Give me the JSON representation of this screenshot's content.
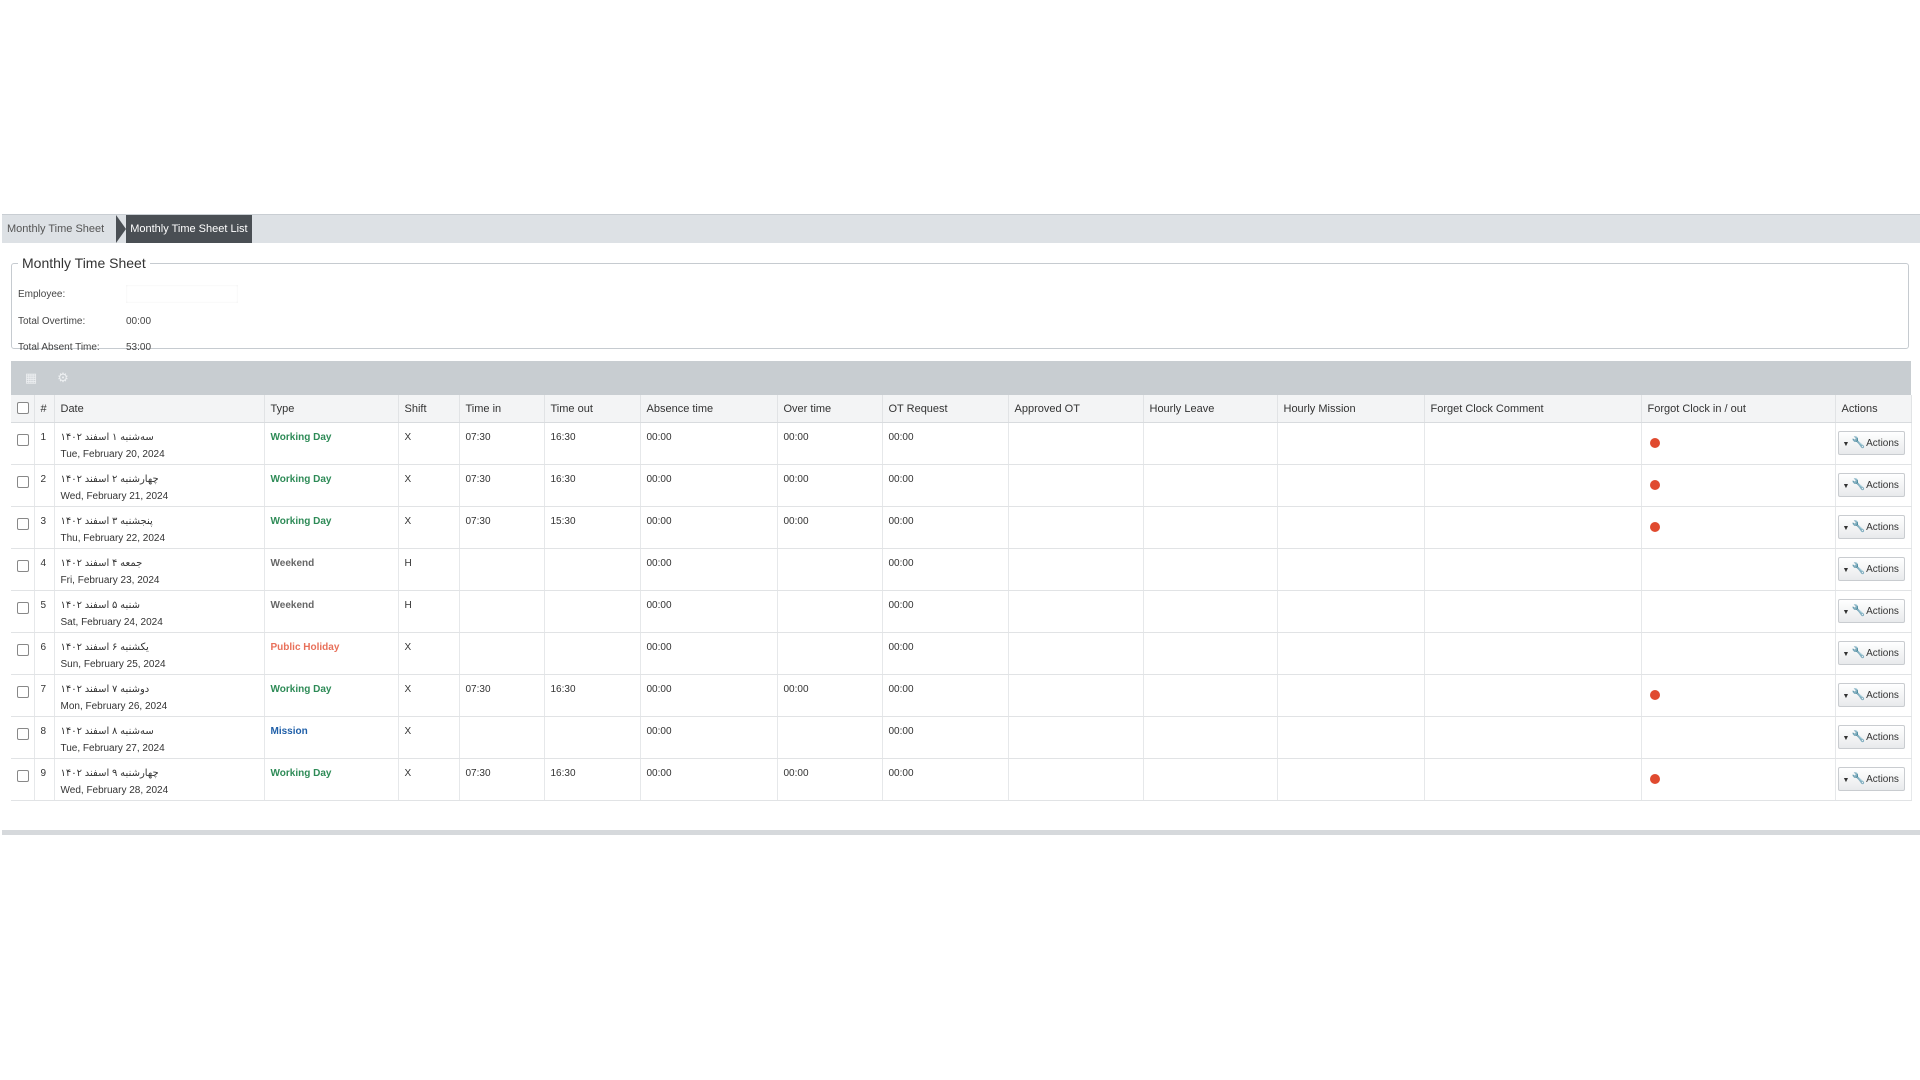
{
  "breadcrumb": {
    "parent": "Monthly Time Sheet",
    "current": "Monthly Time Sheet List"
  },
  "summary": {
    "legend": "Monthly Time Sheet",
    "employee_label": "Employee:",
    "employee_value": "",
    "overtime_label": "Total Overtime:",
    "overtime_value": "00:00",
    "absent_label": "Total Absent Time:",
    "absent_value": "53:00"
  },
  "toolbar": {
    "icons": [
      "export-icon",
      "settings-icon"
    ]
  },
  "columns": [
    "#",
    "Date",
    "Type",
    "Shift",
    "Time in",
    "Time out",
    "Absence time",
    "Over time",
    "OT Request",
    "Approved OT",
    "Hourly Leave",
    "Hourly Mission",
    "Forget Clock Comment",
    "Forgot Clock in / out",
    "Actions"
  ],
  "colors": {
    "working": "#2e8b57",
    "weekend": "#666666",
    "holiday": "#e8705a",
    "mission": "#1f5fa8",
    "forgot_dot": "#e04a2f",
    "breadcrumb_active": "#4a4f54"
  },
  "rows": [
    {
      "num": "1",
      "date_fa": "سه‌شنبه ۱ اسفند ۱۴۰۲",
      "date_en": "Tue, February 20, 2024",
      "type": "Working Day",
      "type_kind": "working",
      "shift": "X",
      "time_in": "07:30",
      "time_out": "16:30",
      "absence": "00:00",
      "overtime": "00:00",
      "ot_request": "00:00",
      "approved_ot": "",
      "hourly_leave": "",
      "hourly_mission": "",
      "comment": "",
      "forgot": true,
      "action": "Actions"
    },
    {
      "num": "2",
      "date_fa": "چهارشنبه ۲ اسفند ۱۴۰۲",
      "date_en": "Wed, February 21, 2024",
      "type": "Working Day",
      "type_kind": "working",
      "shift": "X",
      "time_in": "07:30",
      "time_out": "16:30",
      "absence": "00:00",
      "overtime": "00:00",
      "ot_request": "00:00",
      "approved_ot": "",
      "hourly_leave": "",
      "hourly_mission": "",
      "comment": "",
      "forgot": true,
      "action": "Actions"
    },
    {
      "num": "3",
      "date_fa": "پنجشنبه ۳ اسفند ۱۴۰۲",
      "date_en": "Thu, February 22, 2024",
      "type": "Working Day",
      "type_kind": "working",
      "shift": "X",
      "time_in": "07:30",
      "time_out": "15:30",
      "absence": "00:00",
      "overtime": "00:00",
      "ot_request": "00:00",
      "approved_ot": "",
      "hourly_leave": "",
      "hourly_mission": "",
      "comment": "",
      "forgot": true,
      "action": "Actions"
    },
    {
      "num": "4",
      "date_fa": "جمعه ۴ اسفند ۱۴۰۲",
      "date_en": "Fri, February 23, 2024",
      "type": "Weekend",
      "type_kind": "weekend",
      "shift": "H",
      "time_in": "",
      "time_out": "",
      "absence": "00:00",
      "overtime": "",
      "ot_request": "00:00",
      "approved_ot": "",
      "hourly_leave": "",
      "hourly_mission": "",
      "comment": "",
      "forgot": false,
      "action": "Actions"
    },
    {
      "num": "5",
      "date_fa": "شنبه ۵ اسفند ۱۴۰۲",
      "date_en": "Sat, February 24, 2024",
      "type": "Weekend",
      "type_kind": "weekend",
      "shift": "H",
      "time_in": "",
      "time_out": "",
      "absence": "00:00",
      "overtime": "",
      "ot_request": "00:00",
      "approved_ot": "",
      "hourly_leave": "",
      "hourly_mission": "",
      "comment": "",
      "forgot": false,
      "action": "Actions"
    },
    {
      "num": "6",
      "date_fa": "یکشنبه ۶ اسفند ۱۴۰۲",
      "date_en": "Sun, February 25, 2024",
      "type": "Public Holiday",
      "type_kind": "holiday",
      "shift": "X",
      "time_in": "",
      "time_out": "",
      "absence": "00:00",
      "overtime": "",
      "ot_request": "00:00",
      "approved_ot": "",
      "hourly_leave": "",
      "hourly_mission": "",
      "comment": "",
      "forgot": false,
      "action": "Actions"
    },
    {
      "num": "7",
      "date_fa": "دوشنبه ۷ اسفند ۱۴۰۲",
      "date_en": "Mon, February 26, 2024",
      "type": "Working Day",
      "type_kind": "working",
      "shift": "X",
      "time_in": "07:30",
      "time_out": "16:30",
      "absence": "00:00",
      "overtime": "00:00",
      "ot_request": "00:00",
      "approved_ot": "",
      "hourly_leave": "",
      "hourly_mission": "",
      "comment": "",
      "forgot": true,
      "action": "Actions"
    },
    {
      "num": "8",
      "date_fa": "سه‌شنبه ۸ اسفند ۱۴۰۲",
      "date_en": "Tue, February 27, 2024",
      "type": "Mission",
      "type_kind": "mission",
      "shift": "X",
      "time_in": "",
      "time_out": "",
      "absence": "00:00",
      "overtime": "",
      "ot_request": "00:00",
      "approved_ot": "",
      "hourly_leave": "",
      "hourly_mission": "",
      "comment": "",
      "forgot": false,
      "action": "Actions"
    },
    {
      "num": "9",
      "date_fa": "چهارشنبه ۹ اسفند ۱۴۰۲",
      "date_en": "Wed, February 28, 2024",
      "type": "Working Day",
      "type_kind": "working",
      "shift": "X",
      "time_in": "07:30",
      "time_out": "16:30",
      "absence": "00:00",
      "overtime": "00:00",
      "ot_request": "00:00",
      "approved_ot": "",
      "hourly_leave": "",
      "hourly_mission": "",
      "comment": "",
      "forgot": true,
      "action": "Actions"
    }
  ]
}
